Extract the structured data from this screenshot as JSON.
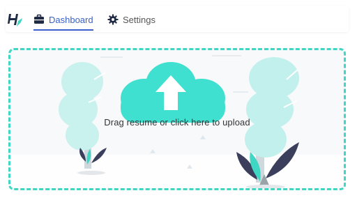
{
  "nav": {
    "logo_icon": "hk-logo-icon",
    "tabs": [
      {
        "label": "Dashboard",
        "icon": "briefcase-icon",
        "active": true
      },
      {
        "label": "Settings",
        "icon": "gear-icon",
        "active": false
      }
    ],
    "active_color": "#3a5fc8"
  },
  "upload": {
    "label": "Drag resume or click here to upload",
    "icon": "cloud-upload-icon",
    "accent_color": "#3fd6c4"
  }
}
